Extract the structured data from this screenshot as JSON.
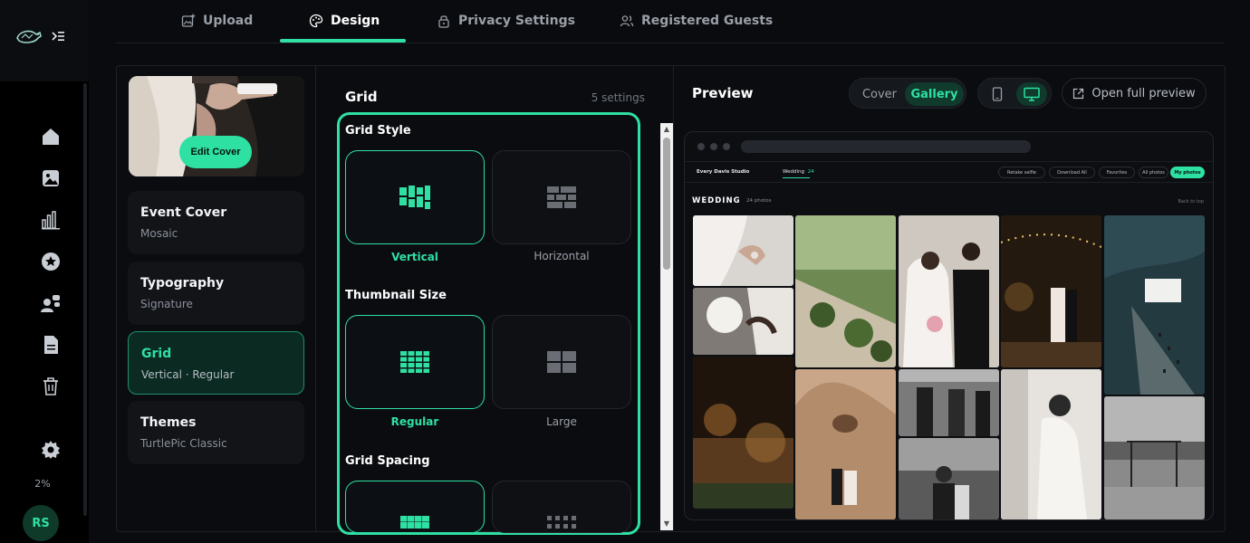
{
  "app": {
    "usage_percent": "2%",
    "user_initials": "RS"
  },
  "tabs": [
    {
      "label": "Upload",
      "icon": "image-plus-icon",
      "active": false
    },
    {
      "label": "Design",
      "icon": "palette-icon",
      "active": true
    },
    {
      "label": "Privacy Settings",
      "icon": "lock-icon",
      "active": false
    },
    {
      "label": "Registered Guests",
      "icon": "users-icon",
      "active": false
    }
  ],
  "sidebar": {
    "items": [
      {
        "icon": "home-icon"
      },
      {
        "icon": "image-icon"
      },
      {
        "icon": "bar-chart-icon"
      },
      {
        "icon": "star-icon"
      },
      {
        "icon": "people-icon"
      },
      {
        "icon": "document-icon"
      },
      {
        "icon": "trash-icon"
      },
      {
        "icon": "gear-icon"
      }
    ]
  },
  "design": {
    "edit_cover_label": "Edit Cover",
    "settings": [
      {
        "title": "Event Cover",
        "value": "Mosaic",
        "active": false
      },
      {
        "title": "Typography",
        "value": "Signature",
        "active": false
      },
      {
        "title": "Grid",
        "value": "Vertical · Regular",
        "active": true
      },
      {
        "title": "Themes",
        "value": "TurtlePic Classic",
        "active": false
      }
    ]
  },
  "grid": {
    "title": "Grid",
    "count": "5 settings",
    "sections": [
      {
        "title": "Grid Style",
        "options": [
          {
            "label": "Vertical",
            "selected": true
          },
          {
            "label": "Horizontal",
            "selected": false
          }
        ]
      },
      {
        "title": "Thumbnail Size",
        "options": [
          {
            "label": "Regular",
            "selected": true
          },
          {
            "label": "Large",
            "selected": false
          }
        ]
      },
      {
        "title": "Grid Spacing",
        "options": [
          {
            "label": "",
            "selected": true
          },
          {
            "label": "",
            "selected": false
          }
        ]
      }
    ]
  },
  "preview": {
    "title": "Preview",
    "modes": [
      "Cover",
      "Gallery"
    ],
    "active_mode": "Gallery",
    "devices": [
      {
        "icon": "mobile-icon",
        "active": false
      },
      {
        "icon": "desktop-icon",
        "active": true
      }
    ],
    "open_full_label": "Open full preview",
    "site": {
      "studio_name": "Every Davis Studio",
      "tab_label": "Wedding",
      "tab_count": "24",
      "buttons": [
        "Retake selfie",
        "Download All",
        "Favorites",
        "All photos",
        "My photos"
      ],
      "selected_button": "My photos",
      "section_title": "WEDDING",
      "photo_count": "24 photos",
      "back_to_top": "Back to top"
    }
  },
  "colors": {
    "accent": "#2fe0a3",
    "background": "#0a0b0e",
    "panel": "#121418"
  }
}
